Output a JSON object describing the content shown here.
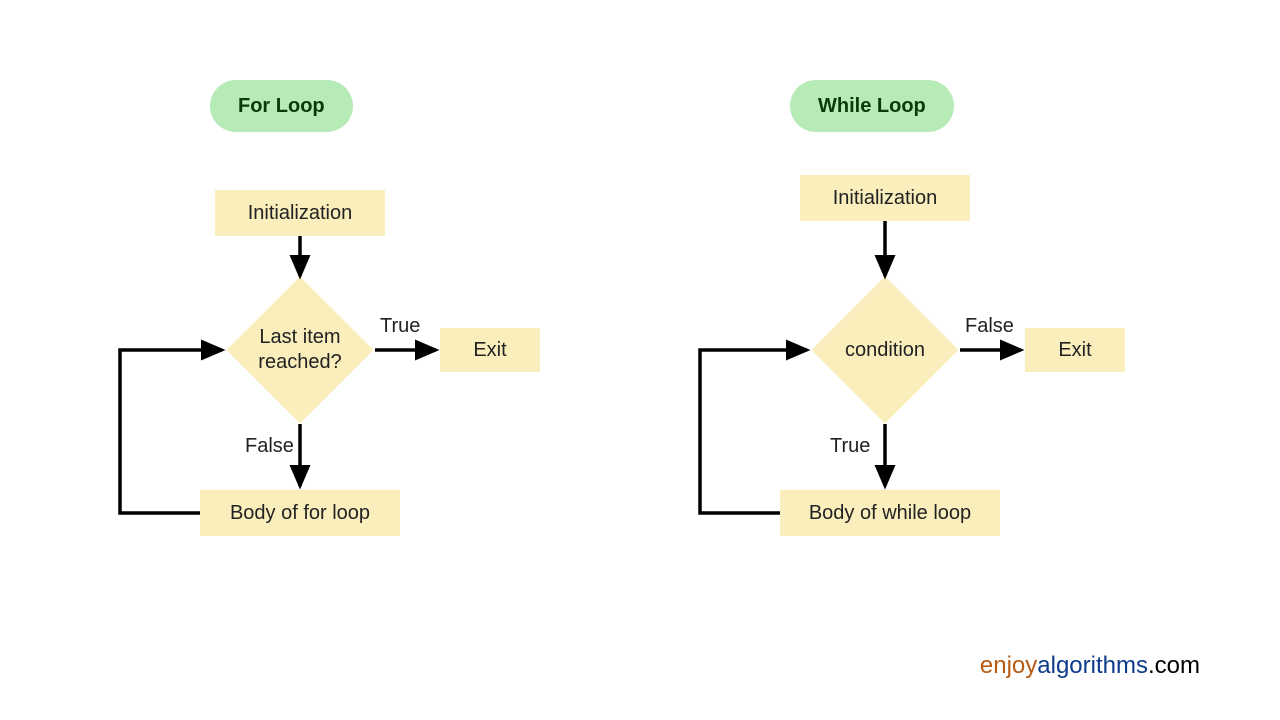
{
  "for_loop": {
    "title": "For Loop",
    "init": "Initialization",
    "decision": "Last item\nreached?",
    "exit": "Exit",
    "body": "Body of for loop",
    "true_label": "True",
    "false_label": "False"
  },
  "while_loop": {
    "title": "While Loop",
    "init": "Initialization",
    "decision": "condition",
    "exit": "Exit",
    "body": "Body of while loop",
    "true_label": "True",
    "false_label": "False"
  },
  "footer": {
    "enjoy": "enjoy",
    "algo": "algorithms",
    "dotcom": ".com"
  },
  "colors": {
    "pill_bg": "#b6eab6",
    "box_bg": "#f9eebc",
    "arrow": "#000000"
  }
}
